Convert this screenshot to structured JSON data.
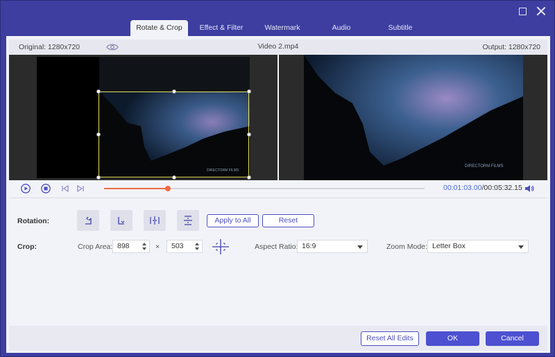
{
  "tabs": [
    {
      "label": "Rotate & Crop",
      "active": true
    },
    {
      "label": "Effect & Filter",
      "active": false
    },
    {
      "label": "Watermark",
      "active": false
    },
    {
      "label": "Audio",
      "active": false
    },
    {
      "label": "Subtitle",
      "active": false
    }
  ],
  "info": {
    "original": "Original: 1280x720",
    "filename": "Video 2.mp4",
    "output": "Output: 1280x720"
  },
  "video_watermark": "DIRECTORM FILMS",
  "player": {
    "current_time": "00:01:03.00",
    "total_time": "/00:05:32.15",
    "progress_fraction": 0.2
  },
  "rotation": {
    "label": "Rotation:",
    "apply_all": "Apply to All",
    "reset": "Reset"
  },
  "crop": {
    "label": "Crop:",
    "area_label": "Crop Area:",
    "width": "898",
    "times": "×",
    "height": "503",
    "aspect_label": "Aspect Ratio:",
    "aspect_value": "16:9",
    "zoom_label": "Zoom Mode:",
    "zoom_value": "Letter Box"
  },
  "footer": {
    "reset_all": "Reset All Edits",
    "ok": "OK",
    "cancel": "Cancel"
  },
  "colors": {
    "accent": "#4d50d0",
    "frame": "#3d3ea0",
    "progress": "#f06a44",
    "crop_border": "#e8e25a"
  }
}
